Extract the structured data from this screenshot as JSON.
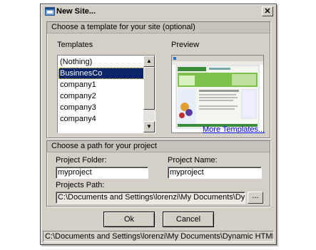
{
  "window": {
    "title": "New Site...",
    "close_label": "✕"
  },
  "template_group": {
    "header": "Choose a template for your site (optional)",
    "templates_label": "Templates",
    "preview_label": "Preview",
    "items": [
      "(Nothing)",
      "BusinnesCo",
      "company1",
      "company2",
      "company3",
      "company4"
    ],
    "selected_index": 1,
    "more_link": "More Templates..."
  },
  "path_group": {
    "header": "Choose a path for your project",
    "project_folder_label": "Project Folder:",
    "project_folder_value": "myproject",
    "project_name_label": "Project Name:",
    "project_name_value": "myproject",
    "projects_path_label": "Projects Path:",
    "projects_path_value": "C:\\Documents and Settings\\lorenzi\\My Documents\\Dynami",
    "browse_label": "..."
  },
  "buttons": {
    "ok": "Ok",
    "cancel": "Cancel"
  },
  "status": {
    "text": "C:\\Documents and Settings\\lorenzi\\My Documents\\Dynamic HTML Editor"
  },
  "colors": {
    "selection": "#0a246a",
    "link": "#0000ee",
    "face": "#d4d0c8"
  }
}
